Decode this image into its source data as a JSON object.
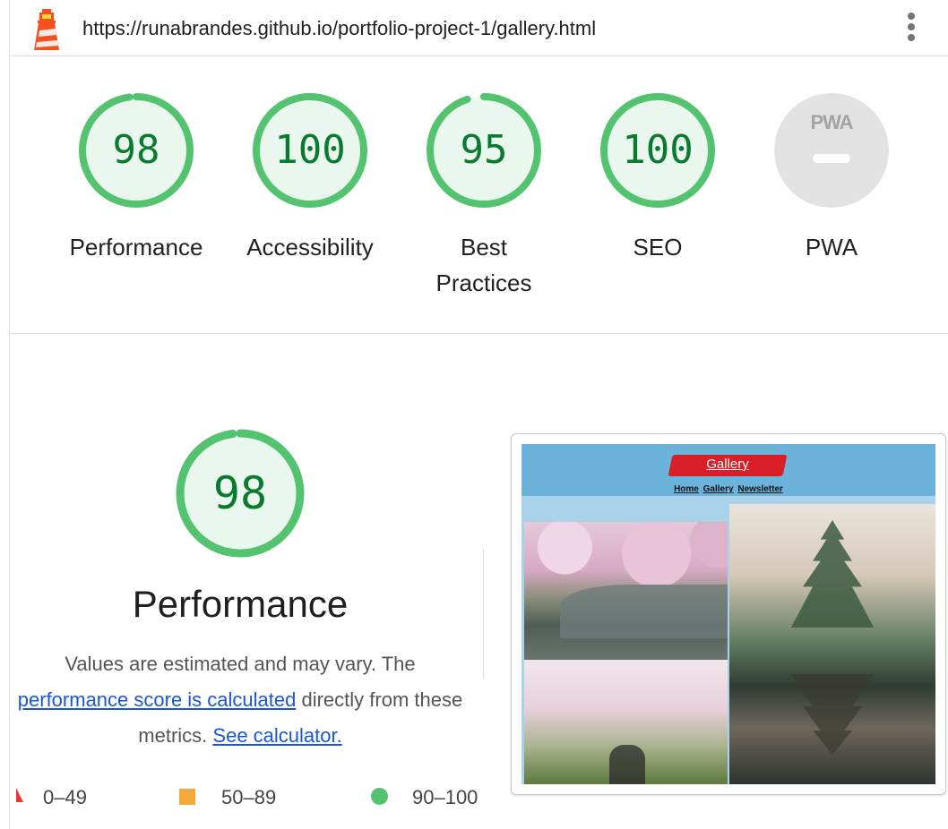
{
  "header": {
    "url": "https://runabrandes.github.io/portfolio-project-1/gallery.html",
    "logo_icon": "lighthouse-icon",
    "menu_icon": "more-vert-icon"
  },
  "gauges": [
    {
      "id": "performance",
      "score": "98",
      "value": 98,
      "label": "Performance"
    },
    {
      "id": "accessibility",
      "score": "100",
      "value": 100,
      "label": "Accessibility"
    },
    {
      "id": "best-practices",
      "score": "95",
      "value": 95,
      "label": "Best Practices"
    },
    {
      "id": "seo",
      "score": "100",
      "value": 100,
      "label": "SEO"
    },
    {
      "id": "pwa",
      "score": "",
      "value": null,
      "label": "PWA",
      "badge": "PWA"
    }
  ],
  "performance": {
    "score": "98",
    "value": 98,
    "title": "Performance",
    "desc_part1": "Values are estimated and may vary. The",
    "link_score": "performance score is calculated",
    "desc_part2": "directly from these metrics.",
    "link_calculator": "See calculator."
  },
  "legend": [
    {
      "range": "0–49",
      "color": "#e53935",
      "shape": "triangle"
    },
    {
      "range": "50–89",
      "color": "#f4a83a",
      "shape": "square"
    },
    {
      "range": "90–100",
      "color": "#54c36f",
      "shape": "circle"
    }
  ],
  "thumbnail": {
    "title": "Gallery",
    "nav": [
      "Home",
      "Gallery",
      "Newsletter"
    ]
  },
  "colors": {
    "pass_stroke": "#54c36f",
    "pass_fill": "#eaf7ee",
    "pass_text": "#0a7a2f",
    "pwa_fill": "#e2e2e2"
  }
}
